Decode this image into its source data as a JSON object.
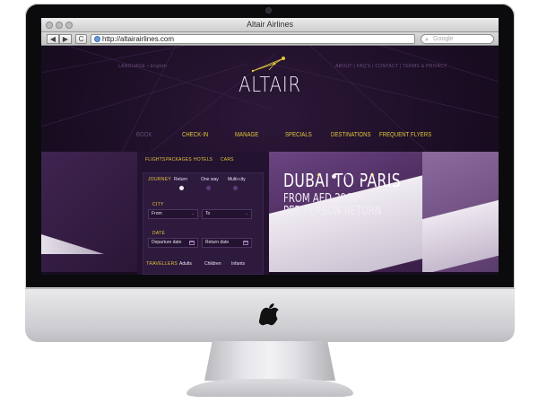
{
  "browser": {
    "window_title": "Altair Airlines",
    "url": "http://altairairlines.com",
    "search_placeholder": "Google",
    "back_label": "◀",
    "forward_label": "▶",
    "reload_label": "C"
  },
  "site": {
    "language_label": "LANGUAGE  ▪  English",
    "top_links": "ABOUT  |  FAQ'S  |  CONTACT  |  TERMS & PRIVACY",
    "logo": "ALTAIR",
    "nav": [
      "BOOK",
      "CHECK-IN",
      "MANAGE",
      "SPECIALS",
      "DESTINATIONS",
      "FREQUENT FLYERS"
    ],
    "booking": {
      "tabs": [
        "FLIGHTS",
        "PACKAGES",
        "HOTELS",
        "CARS"
      ],
      "journey_label": "JOURNEY",
      "journey_options": [
        "Return",
        "One way",
        "Multi-city"
      ],
      "journey_selected": 0,
      "city_label": "CITY",
      "from_label": "From",
      "to_label": "To",
      "date_label": "DATE",
      "departure_label": "Departure date",
      "return_label": "Return date",
      "travellers_label": "TRAVELLERS",
      "traveller_types": [
        "Adults",
        "Children",
        "Infants"
      ]
    },
    "promo": {
      "title": "DUBAI TO PARIS",
      "line1": "FROM AED 2960*",
      "line2": "PER PERSON RETURN"
    },
    "slider": {
      "prev": "‹",
      "next": "›",
      "active_index": 0,
      "count": 3
    }
  },
  "colors": {
    "accent": "#e3c63c",
    "background": "#1b0f24",
    "panel": "#2e1a3d"
  }
}
